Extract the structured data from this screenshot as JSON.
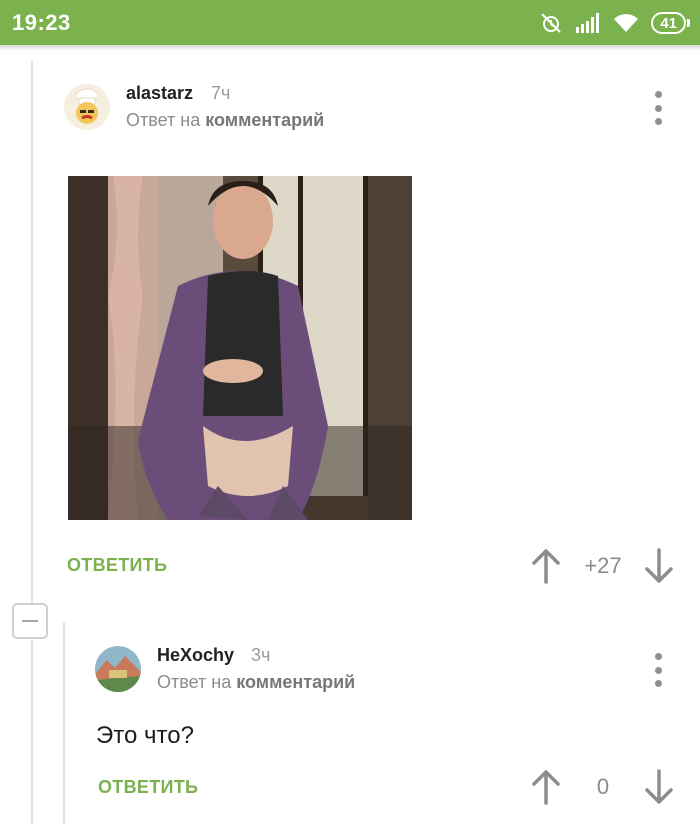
{
  "status_bar": {
    "time": "19:23",
    "battery": "41",
    "icons": [
      "alarm-off-icon",
      "signal-icon",
      "wifi-icon",
      "battery-icon"
    ]
  },
  "comments": [
    {
      "username": "alastarz",
      "time": "7ч",
      "reply_prefix": "Ответ на",
      "reply_target": "комментарий",
      "image_alt": "photo",
      "reply_label": "ОТВЕТИТЬ",
      "rating": "+27"
    },
    {
      "username": "HeXochy",
      "time": "3ч",
      "reply_prefix": "Ответ на",
      "reply_target": "комментарий",
      "text": "Это что?",
      "reply_label": "ОТВЕТИТЬ",
      "rating": "0"
    }
  ],
  "colors": {
    "accent": "#7bb24e",
    "muted": "#8c8c8c",
    "thread": "#e4e4e4"
  }
}
